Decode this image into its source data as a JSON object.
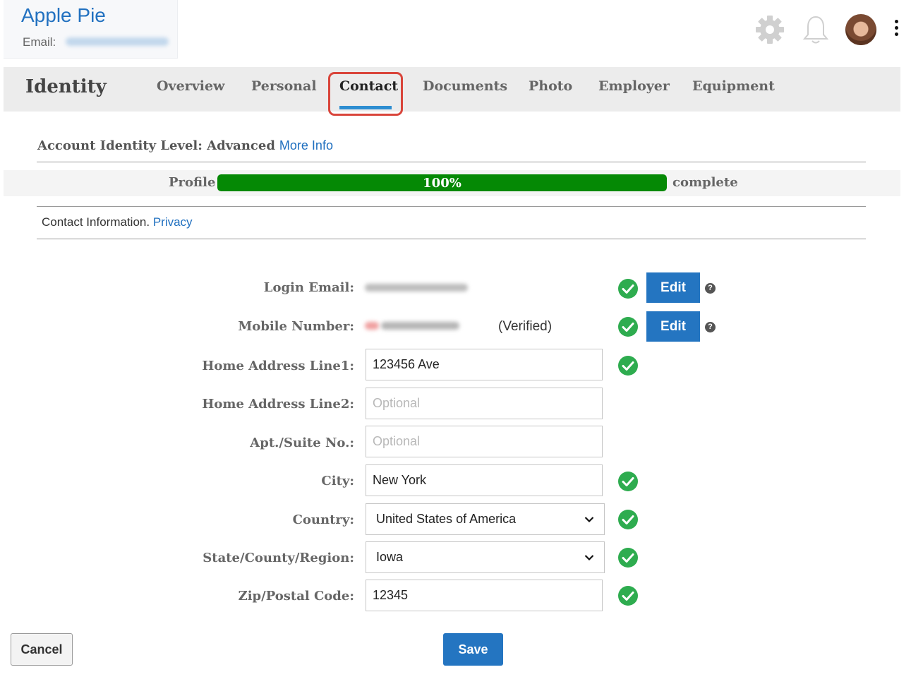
{
  "user": {
    "name": "Apple Pie",
    "email_label": "Email:"
  },
  "header_icons": [
    "gear-icon",
    "bell-icon",
    "avatar",
    "more-vertical-icon"
  ],
  "nav": {
    "section_title": "Identity",
    "tabs": [
      {
        "label": "Overview"
      },
      {
        "label": "Personal"
      },
      {
        "label": "Contact",
        "active": true
      },
      {
        "label": "Documents"
      },
      {
        "label": "Photo"
      },
      {
        "label": "Employer"
      },
      {
        "label": "Equipment"
      }
    ],
    "highlight_color": "#d9453b",
    "accent_color": "#2e8ed1"
  },
  "identity_level": {
    "text": "Account Identity Level: Advanced",
    "link": "More Info"
  },
  "profile_progress": {
    "label": "Profile",
    "percent": 100,
    "text": "100%",
    "suffix": "complete",
    "fill_color": "#058905"
  },
  "contact_info": {
    "text": "Contact Information.",
    "link": "Privacy"
  },
  "form": {
    "login_email_label": "Login Email:",
    "mobile_number_label": "Mobile Number:",
    "mobile_status": "(Verified)",
    "edit_label": "Edit",
    "help_glyph": "?",
    "home_address1_label": "Home Address Line1:",
    "home_address1_value": "123456 Ave",
    "home_address2_label": "Home Address Line2:",
    "home_address2_placeholder": "Optional",
    "apt_label": "Apt./Suite No.:",
    "apt_placeholder": "Optional",
    "city_label": "City:",
    "city_value": "New York",
    "country_label": "Country:",
    "country_value": "United States of America",
    "state_label": "State/County/Region:",
    "state_value": "Iowa",
    "zip_label": "Zip/Postal Code:",
    "zip_value": "12345",
    "check_color": "#2eac4f"
  },
  "actions": {
    "cancel": "Cancel",
    "save": "Save"
  }
}
